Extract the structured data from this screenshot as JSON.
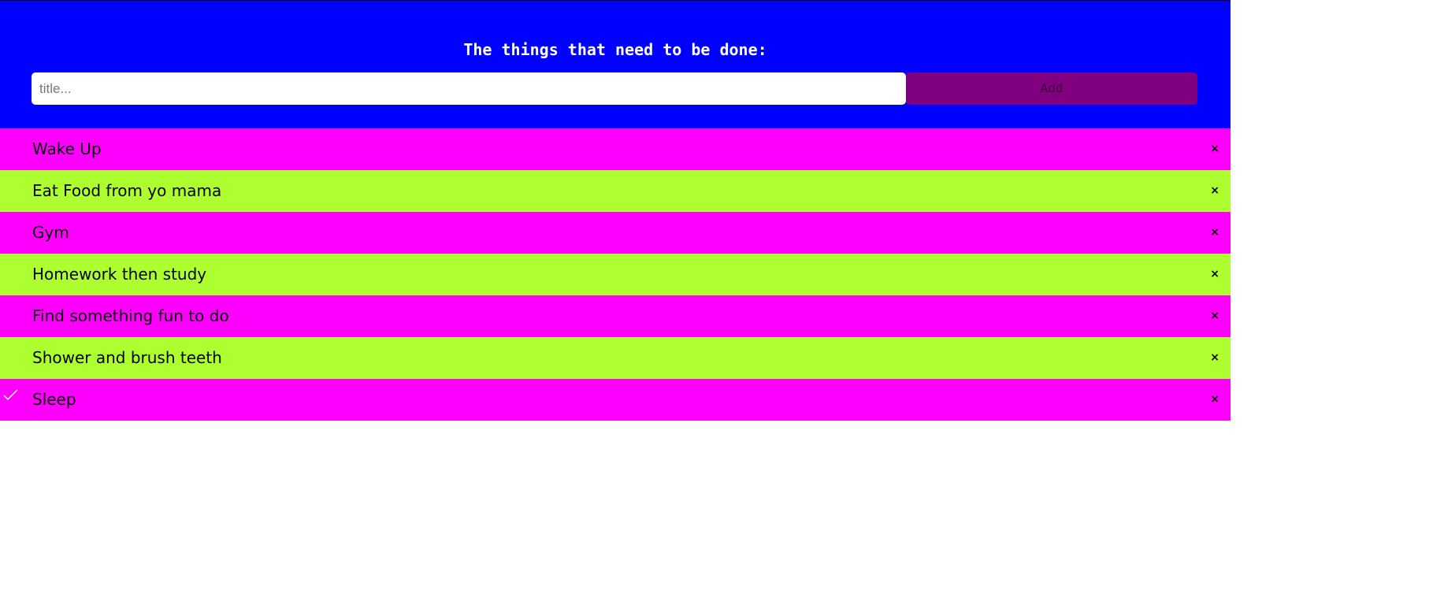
{
  "header": {
    "title": "The things that need to be done:",
    "input_placeholder": "title...",
    "input_value": "",
    "add_label": "Add"
  },
  "todos": [
    {
      "label": "Wake Up",
      "checked": false,
      "color": "#ff00ff",
      "close": "×"
    },
    {
      "label": "Eat Food from yo mama",
      "checked": false,
      "color": "#adff2f",
      "close": "×"
    },
    {
      "label": "Gym",
      "checked": false,
      "color": "#ff00ff",
      "close": "×"
    },
    {
      "label": "Homework then study",
      "checked": false,
      "color": "#adff2f",
      "close": "×"
    },
    {
      "label": "Find something fun to do",
      "checked": false,
      "color": "#ff00ff",
      "close": "×"
    },
    {
      "label": "Shower and brush teeth",
      "checked": false,
      "color": "#adff2f",
      "close": "×"
    },
    {
      "label": "Sleep",
      "checked": true,
      "color": "#ff00ff",
      "close": "×"
    }
  ],
  "colors": {
    "header_bg": "#0000ff",
    "add_button_bg": "#800080",
    "row_pink": "#ff00ff",
    "row_green": "#adff2f"
  },
  "icons": {
    "check": "check-icon",
    "close": "close-icon"
  }
}
